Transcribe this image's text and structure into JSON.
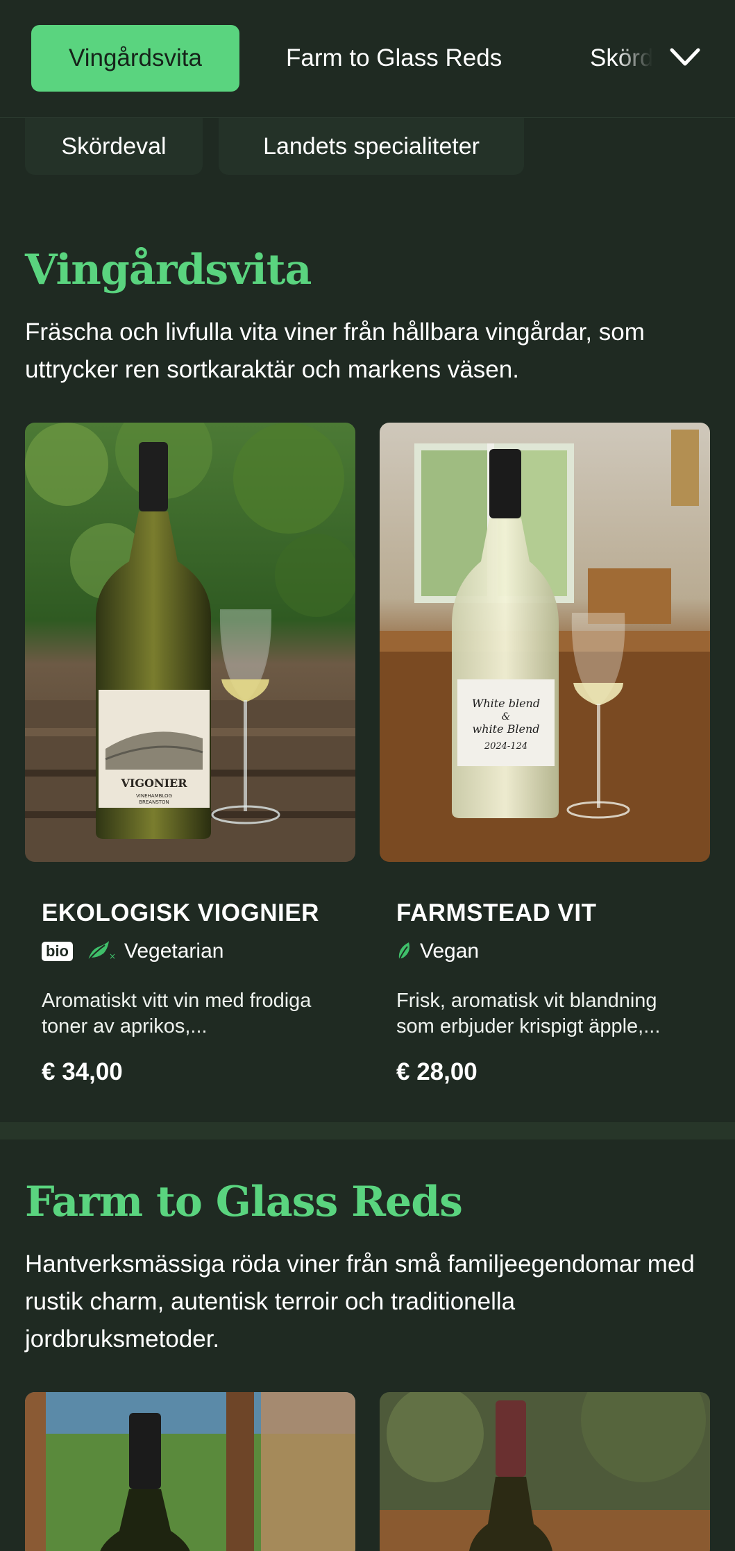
{
  "nav": {
    "tabs": [
      {
        "label": "Vingårdsvita",
        "active": true
      },
      {
        "label": "Farm to Glass Reds",
        "active": false
      },
      {
        "label": "Skördeval",
        "active": false
      }
    ],
    "more_icon": "chevron-down-icon",
    "chips": [
      "Skördeval",
      "Landets specialiteter"
    ]
  },
  "sections": [
    {
      "title": "Vingårdsvita",
      "description": "Fräscha och livfulla vita viner från hållbara vingårdar, som uttrycker ren sortkaraktär och markens väsen.",
      "products": [
        {
          "name": "EKOLOGISK VIOGNIER",
          "badge": "bio",
          "tag_icon": "vegetarian-icon",
          "tag": "Vegetarian",
          "description": "Aromatiskt vitt vin med frodiga toner av aprikos,...",
          "price": "€ 34,00",
          "label_title": "VIGONIER",
          "label_sub": "VINEHAMBLOG",
          "label_sub2": "BREANSTON"
        },
        {
          "name": "FARMSTEAD VIT",
          "tag_icon": "vegan-leaf-icon",
          "tag": "Vegan",
          "description": "Frisk, aromatisk vit blandning som erbjuder krispigt äpple,...",
          "price": "€ 28,00",
          "label_line1": "White blend",
          "label_line2": "&",
          "label_line3": "white Blend",
          "label_line4": "2024-124"
        }
      ]
    },
    {
      "title": "Farm to Glass Reds",
      "description": "Hantverksmässiga röda viner från små familjeegendomar med rustik charm, autentisk terroir och traditionella jordbruksmetoder."
    }
  ],
  "colors": {
    "background": "#1f2a22",
    "accent": "#5ad47f",
    "card": "#243228"
  }
}
